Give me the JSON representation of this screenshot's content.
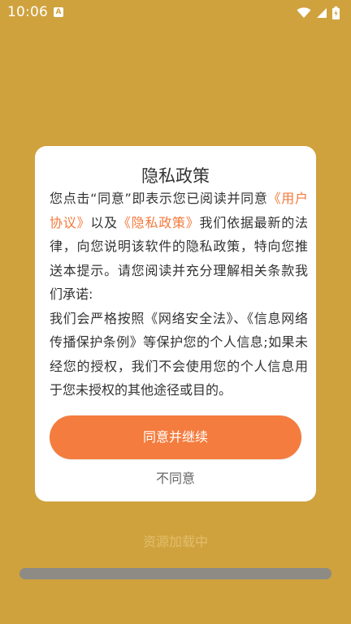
{
  "status_bar": {
    "time": "10:06",
    "notification_letter": "A",
    "icons": [
      "wifi-icon",
      "cell-signal-icon",
      "battery-icon"
    ]
  },
  "dialog": {
    "title": "隐私政策",
    "body": {
      "part1": "您点击“同意”即表示您已阅读并同意",
      "link_user_agreement": "《用户协议》",
      "part2": "以及",
      "link_privacy_policy": "《隐私政策》",
      "part3": "我们依据最新的法律，向您说明该软件的隐私政策，特向您推送本提示。请您阅读并充分理解相关条款我们承诺:",
      "part4": "我们会严格按照《网络安全法》、《信息网络传播保护条例》等保护您的个人信息;如果未经您的授权，我们不会使用您的个人信息用于您未授权的其他途径或目的。"
    },
    "agree_label": "同意并继续",
    "disagree_label": "不同意"
  },
  "loading": {
    "text": "资源加载中",
    "progress": 1.0
  },
  "colors": {
    "background": "#CFA23E",
    "accent": "#F47C3E",
    "link": "#F4793B"
  }
}
